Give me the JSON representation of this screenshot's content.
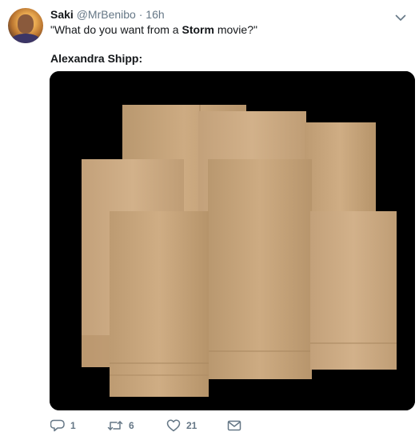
{
  "tweet": {
    "author_name": "Saki",
    "author_handle": "@MrBenibo",
    "separator": "·",
    "time": "16h",
    "line1_prefix": "\"What do you want from a ",
    "line1_bold": "Storm",
    "line1_suffix": " movie?\"",
    "line2": "Alexandra Shipp:",
    "media_description_icon": "photo-paper-bags",
    "actions": {
      "reply_count": "1",
      "retweet_count": "6",
      "like_count": "21"
    }
  },
  "colors": {
    "text": "#14171a",
    "secondary": "#657786",
    "media_background": "#000000",
    "bag": "#c9a77f"
  }
}
